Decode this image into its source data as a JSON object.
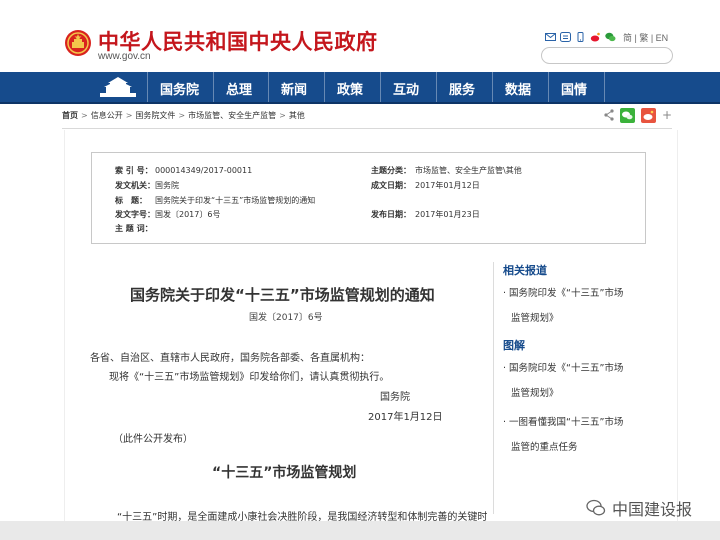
{
  "header": {
    "site_title": "中华人民共和国中央人民政府",
    "site_url": "www.gov.cn",
    "languages": "简 | 繁 | EN",
    "icons": [
      "mail-icon",
      "weibo-square-icon",
      "mobile-icon",
      "wechat-icon",
      "weibo-icon"
    ]
  },
  "nav": {
    "items": [
      "国务院",
      "总理",
      "新闻",
      "政策",
      "互动",
      "服务",
      "数据",
      "国情"
    ]
  },
  "breadcrumb": {
    "items": [
      "首页",
      "信息公开",
      "国务院文件",
      "市场监管、安全生产监管",
      "其他"
    ],
    "separator": ">"
  },
  "share": {
    "icons": [
      "share-icon",
      "wechat-share-icon",
      "weibo-share-icon",
      "plus-icon"
    ],
    "plus_label": "+"
  },
  "meta": {
    "index_label": "索 引 号：",
    "index_value": "000014349/2017-00011",
    "category_label": "主题分类：",
    "category_value": "市场监管、安全生产监管\\其他",
    "issuer_label": "发文机关：",
    "issuer_value": "国务院",
    "created_label": "成文日期：",
    "created_value": "2017年01月12日",
    "title_label": "标　题：",
    "title_value": "国务院关于印发“十三五”市场监管规划的通知",
    "number_label": "发文字号：",
    "number_value": "国发〔2017〕6号",
    "published_label": "发布日期：",
    "published_value": "2017年01月23日",
    "keywords_label": "主 题 词：",
    "keywords_value": ""
  },
  "document": {
    "title": "国务院关于印发“十三五”市场监管规划的通知",
    "doc_number": "国发〔2017〕6号",
    "addressee": "各省、自治区、直辖市人民政府，国务院各部委、各直属机构：",
    "body": "现将《“十三五”市场监管规划》印发给你们，请认真贯彻执行。",
    "signature": "国务院",
    "date": "2017年1月12日",
    "note": "（此件公开发布）",
    "plan_title": "“十三五”市场监管规划",
    "plan_first_line": "“十三五”时期，是全面建成小康社会决胜阶段，是我国经济转型和体制完善的关键时"
  },
  "sidebar": {
    "related_heading": "相关报道",
    "related_items": [
      [
        "国务院印发《“十三五”市场",
        "监管规划》"
      ]
    ],
    "graphics_heading": "图解",
    "graphics_items": [
      [
        "国务院印发《“十三五”市场",
        "监管规划》"
      ],
      [
        "一图看懂我国“十三五”市场",
        "监管的重点任务"
      ]
    ]
  },
  "watermark": {
    "text": "中国建设报"
  },
  "colors": {
    "brand_red": "#c4161c",
    "nav_blue": "#164b8c"
  }
}
